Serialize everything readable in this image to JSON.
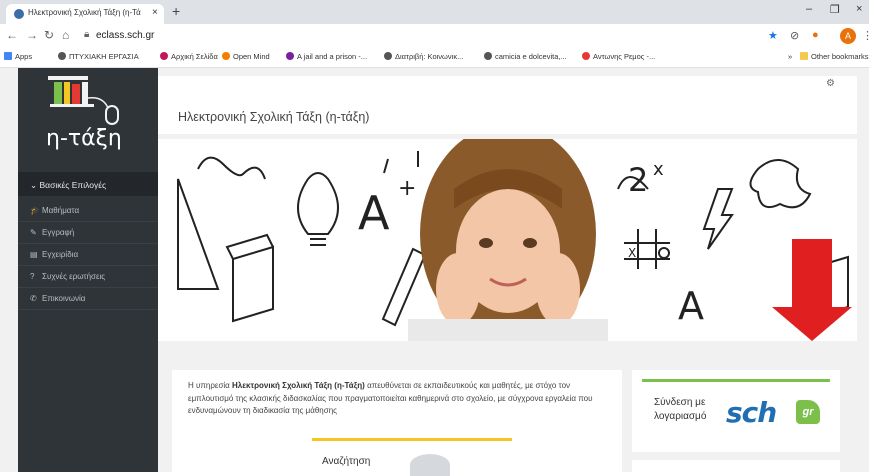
{
  "browser": {
    "tab_title": "Ηλεκτρονική Σχολική Τάξη (η-Τά",
    "tab_close": "×",
    "new_tab": "+",
    "url": "eclass.sch.gr",
    "avatar_letter": "A",
    "window": {
      "minimize": "–",
      "maximize": "❐",
      "close": "×"
    },
    "bookmarks": [
      {
        "label": "Apps",
        "color": "#4285f4"
      },
      {
        "label": "ΠΤΥΧΙΑΚΗ ΕΡΓΑΣΙΑ",
        "color": "#555"
      },
      {
        "label": "Αρχική Σελίδα",
        "color": "#c2185b"
      },
      {
        "label": "Open Mind",
        "color": "#f57c00"
      },
      {
        "label": "A jail and a prison -...",
        "color": "#7b1fa2"
      },
      {
        "label": "Διατριβή: Κοινωνικ...",
        "color": "#555"
      },
      {
        "label": "camicia e dolcevita,...",
        "color": "#555"
      },
      {
        "label": "Αντωνης Ρεμος -...",
        "color": "#e53935"
      }
    ],
    "more_bookmarks": "»",
    "other_bookmarks": "Other bookmarks"
  },
  "sidebar": {
    "logo_text": "η-τάξη",
    "menu_header": "Βασικές Επιλογές",
    "items": [
      {
        "label": "Μαθήματα",
        "icon": "graduation-cap-icon",
        "glyph": "🎓"
      },
      {
        "label": "Εγγραφή",
        "icon": "pencil-square-icon",
        "glyph": "✎"
      },
      {
        "label": "Εγχειρίδια",
        "icon": "document-icon",
        "glyph": "▤"
      },
      {
        "label": "Συχνές ερωτήσεις",
        "icon": "question-circle-icon",
        "glyph": "?"
      },
      {
        "label": "Επικοινωνία",
        "icon": "phone-icon",
        "glyph": "✆"
      }
    ]
  },
  "main": {
    "title": "Ηλεκτρονική Σχολική Τάξη (η-τάξη)",
    "info_pre": "Η υπηρεσία ",
    "info_bold": "Ηλεκτρονική Σχολική Τάξη (η-Τάξη)",
    "info_post": " απευθύνεται σε εκπαιδευτικούς και μαθητές, με στόχο τον εμπλουτισμό της κλασικής διδασκαλίας που πραγματοποιείται καθημερινά στο σχολείο, με σύγχρονα εργαλεία που ενδυναμώνουν τη διαδικασία της μάθησης",
    "search_label": "Αναζήτηση",
    "login_label": "Σύνδεση με λογαριασμό",
    "sch_logo": "sch",
    "sch_gr": "gr"
  },
  "colors": {
    "sidebar_bg": "#2f3439",
    "arrow_red": "#e02020",
    "accent_green": "#7cc04b",
    "accent_yellow": "#f3c623",
    "sch_blue": "#1f6fb2"
  }
}
